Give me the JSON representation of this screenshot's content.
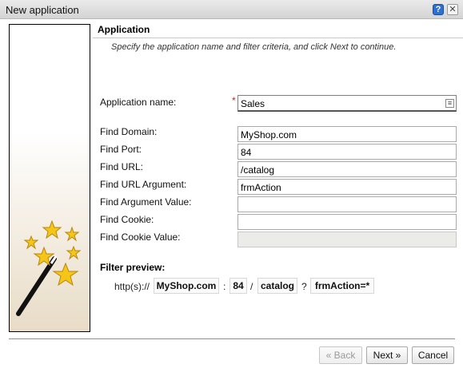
{
  "window": {
    "title": "New application"
  },
  "header": {
    "section_title": "Application",
    "instruction": "Specify the application name and filter criteria, and click Next to continue."
  },
  "form": {
    "app_name_label": "Application name:",
    "app_name_value": "Sales",
    "required_mark": "*",
    "fields": [
      {
        "label": "Find Domain:",
        "value": "MyShop.com"
      },
      {
        "label": "Find Port:",
        "value": "84"
      },
      {
        "label": "Find URL:",
        "value": "/catalog"
      },
      {
        "label": "Find URL Argument:",
        "value": "frmAction"
      },
      {
        "label": "Find Argument Value:",
        "value": ""
      },
      {
        "label": "Find Cookie:",
        "value": ""
      },
      {
        "label": "Find Cookie Value:",
        "value": ""
      }
    ]
  },
  "preview": {
    "label": "Filter preview:",
    "scheme": "http(s)://",
    "domain": "MyShop.com",
    "port_sep": ":",
    "port": "84",
    "path_sep": "/",
    "path": "catalog",
    "query_sep": "?",
    "query": "frmAction=*"
  },
  "buttons": {
    "back": "« Back",
    "next": "Next »",
    "cancel": "Cancel"
  },
  "icons": {
    "help": "help-icon",
    "close": "close-icon",
    "wizard": "magic-wand-stars-icon",
    "field_lookup": "field-lookup-icon"
  },
  "colors": {
    "star": "#f5c518",
    "star_outline": "#b8860b",
    "required": "#d02020",
    "help_blue": "#2f6fd1"
  }
}
